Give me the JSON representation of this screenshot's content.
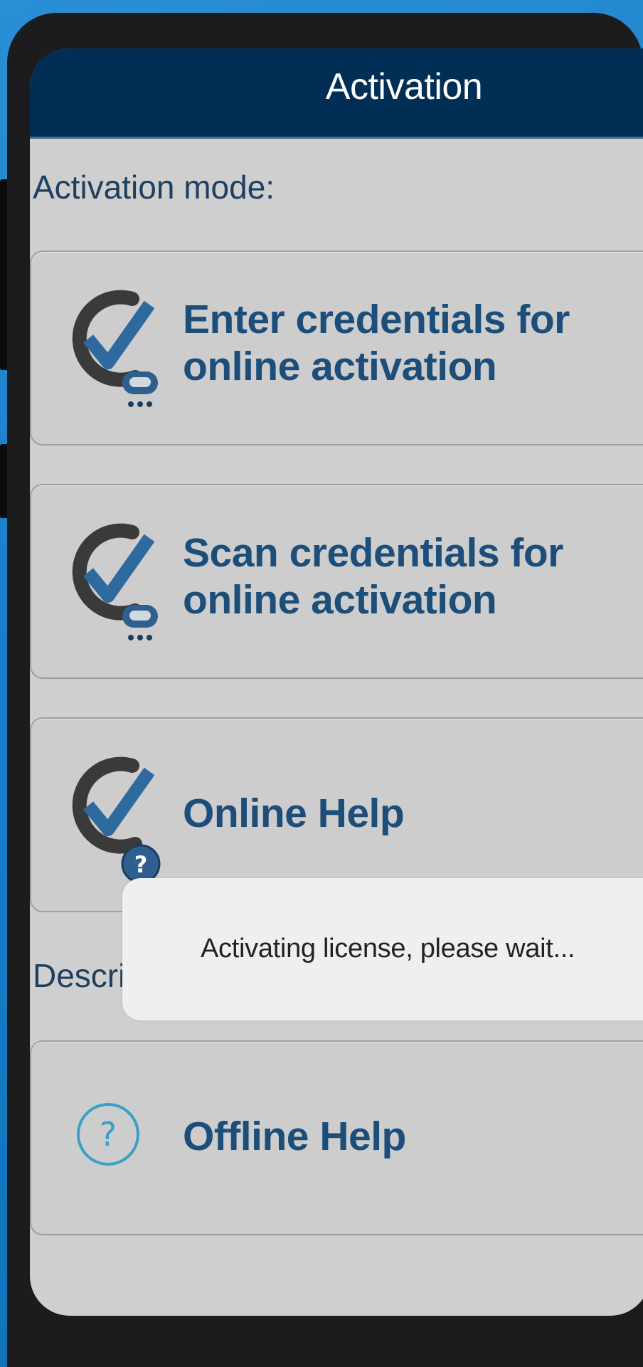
{
  "navbar": {
    "title": "Activation"
  },
  "section_activation_mode": "Activation mode:",
  "section_description": "Description:",
  "cards": [
    {
      "label": "Enter credentials for online activation",
      "line1": "Enter credentials for",
      "line2": "online activation",
      "icon": "checkmark-keyboard-icon"
    },
    {
      "label": "Scan credentials for online activation",
      "line1": "Scan credentials for",
      "line2": "online activation",
      "icon": "checkmark-keyboard-icon"
    },
    {
      "label": "Online Help",
      "icon": "checkmark-help-icon"
    },
    {
      "label": "Offline Help",
      "icon": "help-circle-icon"
    }
  ],
  "toast": {
    "message": "Activating license, please wait..."
  },
  "colors": {
    "navbar": "#012e54",
    "accent_text": "#1d4d79",
    "background": "#cfcfcf",
    "icon_blue": "#2e6a9e"
  }
}
